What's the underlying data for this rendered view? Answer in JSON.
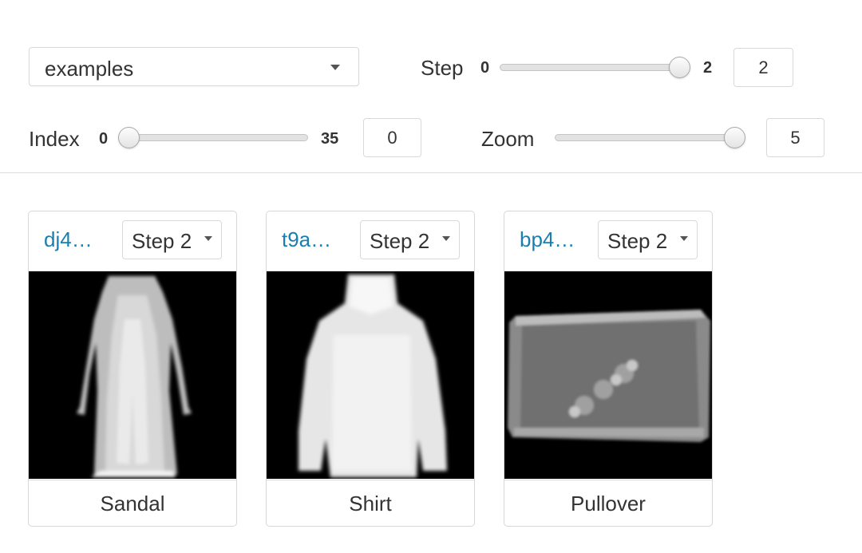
{
  "controls": {
    "panel_select": {
      "value": "examples"
    },
    "step": {
      "label": "Step",
      "min": "0",
      "max": "2",
      "value": "2",
      "fraction": 1.0
    },
    "index": {
      "label": "Index",
      "min": "0",
      "max": "35",
      "value": "0",
      "fraction": 0.0
    },
    "zoom": {
      "label": "Zoom",
      "value": "5",
      "fraction": 1.0
    }
  },
  "cards": [
    {
      "run": "dj4…",
      "step": "Step 2",
      "caption": "Sandal",
      "image": "dress"
    },
    {
      "run": "t9a…",
      "step": "Step 2",
      "caption": "Shirt",
      "image": "pullover"
    },
    {
      "run": "bp4…",
      "step": "Step 2",
      "caption": "Pullover",
      "image": "bag"
    }
  ],
  "colors": {
    "run_link": "#1a7fb0",
    "image_bg": "#000000"
  }
}
